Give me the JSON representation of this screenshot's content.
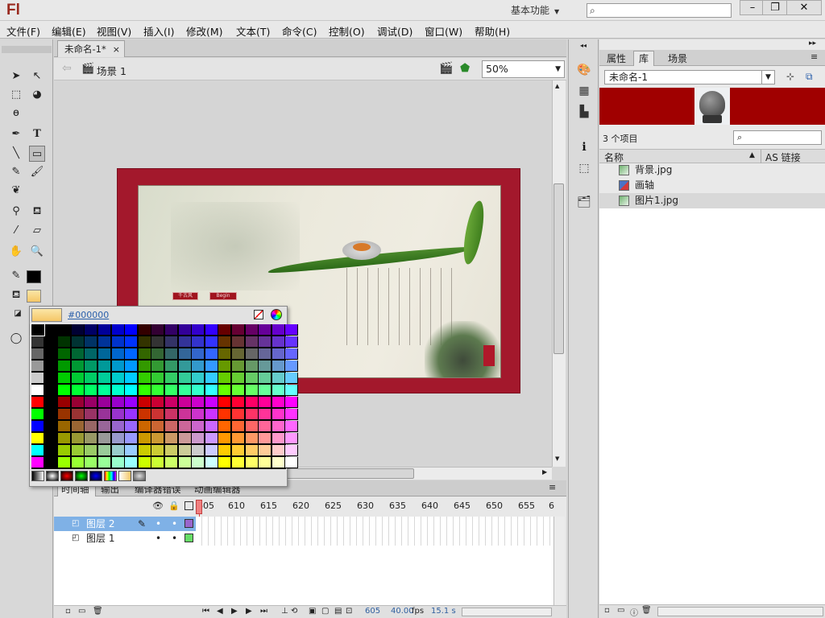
{
  "app": {
    "logo": "Fl",
    "workspace": "基本功能"
  },
  "menu": [
    "文件(F)",
    "编辑(E)",
    "视图(V)",
    "插入(I)",
    "修改(M)",
    "文本(T)",
    "命令(C)",
    "控制(O)",
    "调试(D)",
    "窗口(W)",
    "帮助(H)"
  ],
  "document": {
    "tab": "未命名-1*",
    "close": "×",
    "scene": "场景 1",
    "zoom": "50%"
  },
  "color_picker": {
    "hex": "#000000"
  },
  "timeline": {
    "tabs": [
      "时间轴",
      "输出",
      "编译器错误",
      "动画编辑器"
    ],
    "ruler": [
      "605",
      "610",
      "615",
      "620",
      "625",
      "630",
      "635",
      "640",
      "645",
      "650",
      "655",
      "6"
    ],
    "layers": [
      {
        "name": "图层 2",
        "color": "#9966cc"
      },
      {
        "name": "图层 1",
        "color": "#66dd66"
      }
    ],
    "status": {
      "frame": "605",
      "fps": "40.00",
      "fps_unit": "fps",
      "time": "15.1 s"
    }
  },
  "library": {
    "tabs": [
      "属性",
      "库",
      "场景"
    ],
    "active_tab": "库",
    "doc": "未命名-1",
    "count": "3 个项目",
    "col_name": "名称",
    "col_link": "AS 链接",
    "items": [
      "背景.jpg",
      "画轴",
      "图片1.jpg"
    ]
  },
  "artwork": {
    "btn1": "千古风",
    "btn2": "Begin"
  }
}
